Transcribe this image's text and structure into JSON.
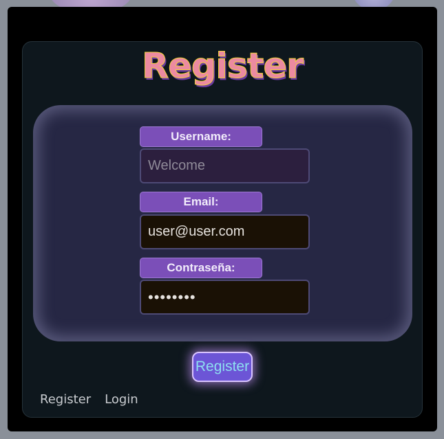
{
  "page": {
    "title": "Register"
  },
  "form": {
    "username": {
      "label": "Username:",
      "placeholder": "Welcome",
      "value": ""
    },
    "email": {
      "label": "Email:",
      "value": "user@user.com"
    },
    "password": {
      "label": "Contraseña:",
      "value": "••••••••"
    }
  },
  "actions": {
    "register_label": "Register"
  },
  "nav": {
    "items": [
      {
        "label": "Register"
      },
      {
        "label": "Login"
      }
    ]
  },
  "colors": {
    "page_bg": "#8a9099",
    "frame_bg": "#000000",
    "card_bg": "#0e171d",
    "panel_bg": "#262744",
    "label_bg": "#7b4fb8",
    "button_bg": "#6c55d6",
    "title_fill": "#ec8aa1",
    "title_outline": "#f0d23b"
  }
}
